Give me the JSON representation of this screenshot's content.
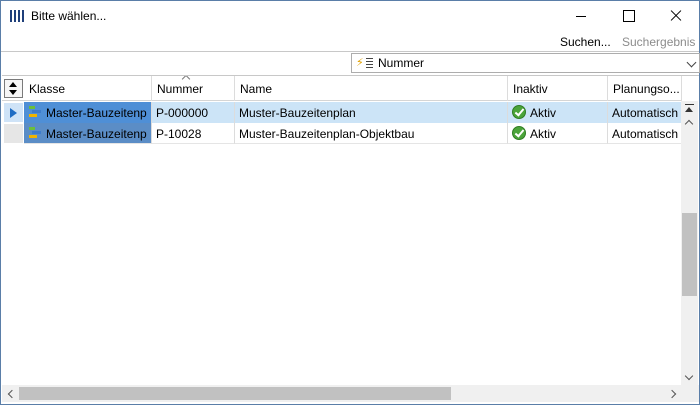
{
  "window": {
    "title": "Bitte wählen...",
    "icon": "app-barcode-icon"
  },
  "toolbar": {
    "search_label": "Suchen...",
    "result_label": "Suchergebnis"
  },
  "sort": {
    "selected": "Nummer",
    "icon": "sort-lightning-icon"
  },
  "grid": {
    "columns": [
      "Klasse",
      "Nummer",
      "Name",
      "Inaktiv",
      "Planungso..."
    ],
    "sorted_column": "Nummer",
    "rows": [
      {
        "klasse": "Master-Bauzeitenp",
        "nummer": "P-000000",
        "name": "Muster-Bauzeitenplan",
        "inaktiv": "Aktiv",
        "planung": "Automatisch",
        "selected": true
      },
      {
        "klasse": "Master-Bauzeitenp",
        "nummer": "P-10028",
        "name": "Muster-Bauzeitenplan-Objektbau",
        "inaktiv": "Aktiv",
        "planung": "Automatisch",
        "selected": false
      }
    ]
  },
  "colors": {
    "selected_row": "#cce4f7",
    "klasse_cell": "#4f8fd6",
    "active_check": "#4ba43a",
    "disabled_text": "#8c8c8c"
  }
}
